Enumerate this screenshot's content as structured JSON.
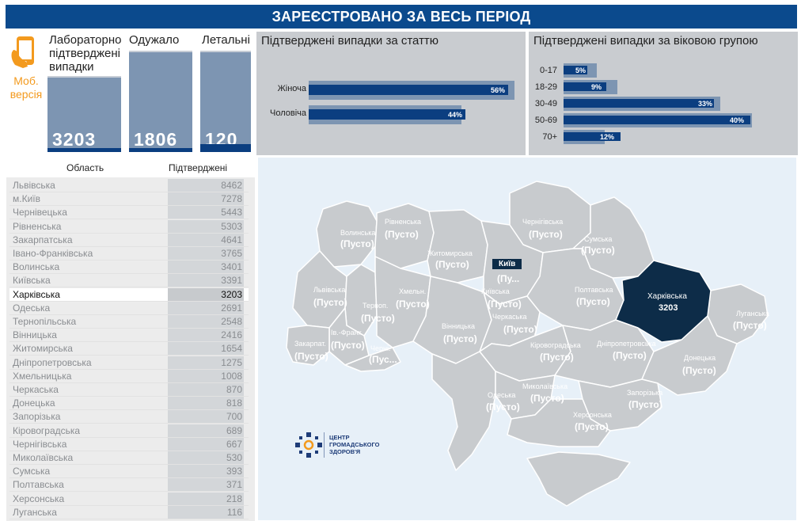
{
  "header": {
    "title": "ЗАРЕЄСТРОВАНО ЗА ВЕСЬ ПЕРІОД"
  },
  "mobile": {
    "line1": "Моб.",
    "line2": "версія",
    "icon": "phone-hand-icon"
  },
  "kpis": [
    {
      "label": "Лабораторно підтверджені випадки",
      "value": "3203"
    },
    {
      "label": "Одужало",
      "value": "1806"
    },
    {
      "label": "Летальні",
      "value": "120"
    }
  ],
  "sex_panel": {
    "title": "Підтверджені випадки за статтю",
    "rows": [
      {
        "label": "Жіноча",
        "pct_label": "56%",
        "value": 56
      },
      {
        "label": "Чоловіча",
        "pct_label": "44%",
        "value": 44
      }
    ]
  },
  "age_panel": {
    "title": "Підтверджені випадки за віковою групою",
    "rows": [
      {
        "label": "0-17",
        "pct_label": "5%",
        "value": 5
      },
      {
        "label": "18-29",
        "pct_label": "9%",
        "value": 9
      },
      {
        "label": "30-49",
        "pct_label": "33%",
        "value": 33
      },
      {
        "label": "50-69",
        "pct_label": "40%",
        "value": 40
      },
      {
        "label": "70+",
        "pct_label": "12%",
        "value": 12
      }
    ]
  },
  "table": {
    "col_region": "Область",
    "col_confirmed": "Підтверджені",
    "rows": [
      {
        "region": "Львівська",
        "value": "8462"
      },
      {
        "region": "м.Київ",
        "value": "7278"
      },
      {
        "region": "Чернівецька",
        "value": "5443"
      },
      {
        "region": "Рівненська",
        "value": "5303"
      },
      {
        "region": "Закарпатська",
        "value": "4641"
      },
      {
        "region": "Івано-Франківська",
        "value": "3765"
      },
      {
        "region": "Волинська",
        "value": "3401"
      },
      {
        "region": "Київська",
        "value": "3391"
      },
      {
        "region": "Харківська",
        "value": "3203",
        "selected": true
      },
      {
        "region": "Одеська",
        "value": "2691"
      },
      {
        "region": "Тернопільська",
        "value": "2548"
      },
      {
        "region": "Вінницька",
        "value": "2416"
      },
      {
        "region": "Житомирська",
        "value": "1654"
      },
      {
        "region": "Дніпропетровська",
        "value": "1275"
      },
      {
        "region": "Хмельницька",
        "value": "1008"
      },
      {
        "region": "Черкаська",
        "value": "870"
      },
      {
        "region": "Донецька",
        "value": "818"
      },
      {
        "region": "Запорізька",
        "value": "700"
      },
      {
        "region": "Кіровоградська",
        "value": "689"
      },
      {
        "region": "Чернігівська",
        "value": "667"
      },
      {
        "region": "Миколаївська",
        "value": "530"
      },
      {
        "region": "Сумська",
        "value": "393"
      },
      {
        "region": "Полтавська",
        "value": "371"
      },
      {
        "region": "Херсонська",
        "value": "218"
      },
      {
        "region": "Луганська",
        "value": "116"
      }
    ]
  },
  "map": {
    "highlight_color": "#0d2c48",
    "region_color": "#c8cbce",
    "regions": [
      {
        "name": "Волинська",
        "value": "(Пусто)"
      },
      {
        "name": "Рівненська",
        "value": "(Пусто)"
      },
      {
        "name": "Житомирська",
        "value": "(Пусто)"
      },
      {
        "name": "Чернігівська",
        "value": "(Пусто)"
      },
      {
        "name": "Сумська",
        "value": "(Пусто)"
      },
      {
        "name": "Київ",
        "value": "(Пу..."
      },
      {
        "name": "Львівська",
        "value": "(Пусто)"
      },
      {
        "name": "Терноп.",
        "value": "(Пусто)"
      },
      {
        "name": "Хмельн.",
        "value": "(Пусто)"
      },
      {
        "name": "Київська",
        "value": "(Пусто)"
      },
      {
        "name": "Полтавська",
        "value": "(Пусто)"
      },
      {
        "name": "Харківська",
        "value": "3203"
      },
      {
        "name": "Луганська",
        "value": "(Пусто)"
      },
      {
        "name": "Вінницька",
        "value": "(Пусто)"
      },
      {
        "name": "Черкаська",
        "value": "(Пусто)"
      },
      {
        "name": "Ів.-Франк.",
        "value": "(Пусто)"
      },
      {
        "name": "Закарпат.",
        "value": "(Пусто)"
      },
      {
        "name": "Черні.",
        "value": "(Пус..."
      },
      {
        "name": "Кіровоградська",
        "value": "(Пусто)"
      },
      {
        "name": "Дніпропетровська",
        "value": "(Пусто)"
      },
      {
        "name": "Донецька",
        "value": "(Пусто)"
      },
      {
        "name": "Одеська",
        "value": "(Пусто)"
      },
      {
        "name": "Миколаївська",
        "value": "(Пусто)"
      },
      {
        "name": "Запорізька",
        "value": "(Пусто)"
      },
      {
        "name": "Херсонська",
        "value": "(Пусто)"
      }
    ],
    "logo_text": [
      "ЦЕНТР",
      "ГРОМАДСЬКОГО",
      "ЗДОРОВ'Я"
    ]
  }
}
